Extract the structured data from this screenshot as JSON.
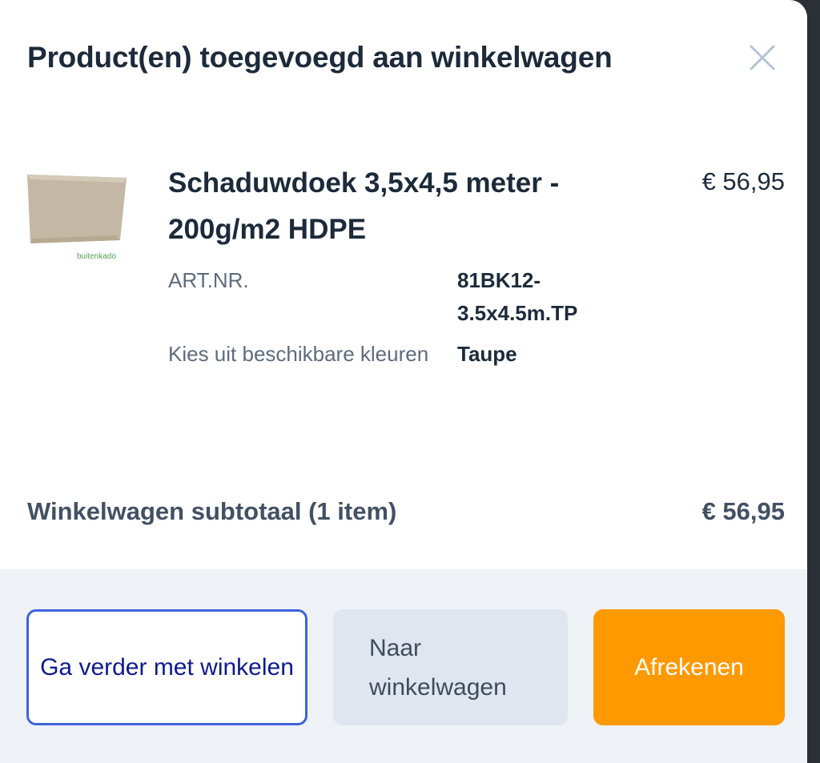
{
  "modal": {
    "title": "Product(en) toegevoegd aan winkelwagen",
    "close_icon": "close-icon"
  },
  "product": {
    "name": "Schaduwdoek 3,5x4,5 meter - 200g/m2 HDPE",
    "price": "€ 56,95",
    "thumbnail_brand_text": "buitenkado",
    "attributes": [
      {
        "label": "ART.NR.",
        "value": "81BK12-3.5x4.5m.TP"
      },
      {
        "label": "Kies uit beschikbare kleuren",
        "value": "Taupe"
      }
    ]
  },
  "subtotal": {
    "label": "Winkelwagen subtotaal (1 item)",
    "value": "€ 56,95"
  },
  "buttons": {
    "continue_label": "Ga verder met winkelen",
    "cart_label": "Naar winkelwagen",
    "checkout_label": "Afrekenen"
  },
  "colors": {
    "checkout_button": "#ff9900",
    "continue_border": "#3d63dd",
    "continue_text": "#0d1a8c",
    "cart_button_bg": "#e0e6ef",
    "footer_bg": "#eef2f7",
    "title_text": "#1c2a3a"
  }
}
